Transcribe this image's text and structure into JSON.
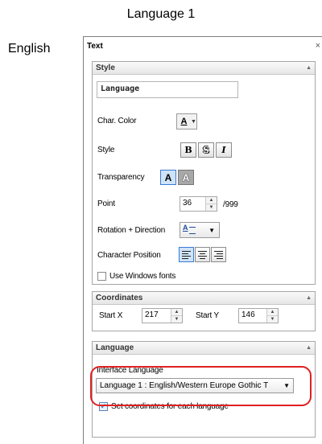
{
  "heading": "Language 1",
  "side_label": "English",
  "panel": {
    "title": "Text",
    "close_glyph": "×"
  },
  "style": {
    "title": "Style",
    "text_value": "Language",
    "char_color_label": "Char. Color",
    "char_color_glyph": "A",
    "style_label": "Style",
    "style_buttons": [
      "B",
      "S",
      "I"
    ],
    "transparency_label": "Transparency",
    "transparency_buttons": [
      "A",
      "A"
    ],
    "point_label": "Point",
    "point_value": "36",
    "point_max": "/999",
    "rotation_label": "Rotation + Direction",
    "char_position_label": "Character Position",
    "use_windows_fonts_label": "Use Windows fonts",
    "use_windows_fonts_checked": false
  },
  "coordinates": {
    "title": "Coordinates",
    "start_x_label": "Start X",
    "start_x_value": "217",
    "start_y_label": "Start Y",
    "start_y_value": "146"
  },
  "language": {
    "title": "Language",
    "interface_label": "Interface Language",
    "selected": "Language 1 : English/Western Europe Gothic T",
    "set_coords_label": "Set coordinates for each language",
    "set_coords_checked": true
  },
  "colors": {
    "highlight": "#e02020",
    "active_button": "#cfe3f8"
  }
}
